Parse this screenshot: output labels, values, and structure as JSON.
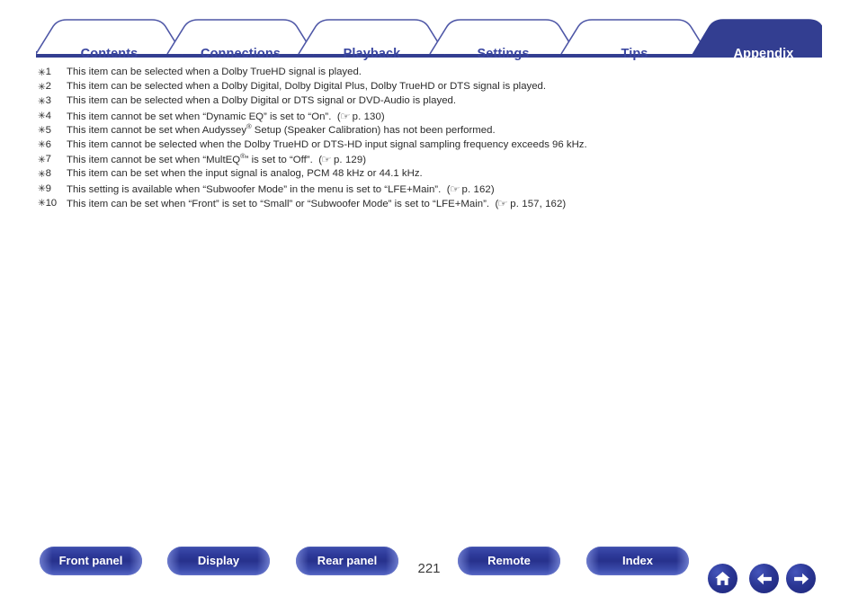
{
  "document": {
    "page_number": "221",
    "active_tab": "Appendix"
  },
  "tabs": [
    {
      "label": "Contents",
      "active": false
    },
    {
      "label": "Connections",
      "active": false
    },
    {
      "label": "Playback",
      "active": false
    },
    {
      "label": "Settings",
      "active": false
    },
    {
      "label": "Tips",
      "active": false
    },
    {
      "label": "Appendix",
      "active": true
    }
  ],
  "footnotes": [
    {
      "marker": "1",
      "text": "This item can be selected when a Dolby TrueHD signal is played."
    },
    {
      "marker": "2",
      "text": "This item can be selected when a Dolby Digital, Dolby Digital Plus, Dolby TrueHD or DTS signal is played."
    },
    {
      "marker": "3",
      "text": "This item can be selected when a Dolby Digital or DTS signal or DVD-Audio is played."
    },
    {
      "marker": "4",
      "text": "This item cannot be set when “Dynamic EQ” is set to “On”.",
      "reference": "p. 130"
    },
    {
      "marker": "5",
      "text_before_sup": "This item cannot be set when Audyssey",
      "sup": "®",
      "text_after_sup": " Setup (Speaker Calibration) has not been performed."
    },
    {
      "marker": "6",
      "text": "This item cannot be selected when the Dolby TrueHD or DTS-HD input signal sampling frequency exceeds 96 kHz."
    },
    {
      "marker": "7",
      "text_before_sup": "This item cannot be set when “MultEQ",
      "sup": "®",
      "text_after_sup": "” is set to “Off”.",
      "reference": "p. 129"
    },
    {
      "marker": "8",
      "text": "This item can be set when the input signal is analog, PCM 48 kHz or 44.1 kHz."
    },
    {
      "marker": "9",
      "text": "This setting is available when “Subwoofer Mode” in the menu is set to “LFE+Main”.",
      "reference": "p. 162"
    },
    {
      "marker": "10",
      "text": "This item can be set when “Front” is set to “Small” or “Subwoofer Mode” is set to “LFE+Main”.",
      "reference": "p. 157,  162"
    }
  ],
  "bottom_nav": {
    "buttons": [
      {
        "label": "Front panel"
      },
      {
        "label": "Display"
      },
      {
        "label": "Rear panel"
      },
      {
        "label": "Remote"
      },
      {
        "label": "Index"
      }
    ],
    "icons": [
      {
        "name": "home-icon"
      },
      {
        "name": "arrow-left-icon"
      },
      {
        "name": "arrow-right-icon"
      }
    ]
  },
  "colors": {
    "tab_blue": "#3a46a0",
    "tab_active_bg": "#333e91",
    "rule_blue": "#333e91",
    "pill_blue": "#2e3a9a",
    "text_gray": "#2b2b2b"
  },
  "symbols": {
    "asterisk": "✳",
    "hand_pointer": "☞"
  }
}
